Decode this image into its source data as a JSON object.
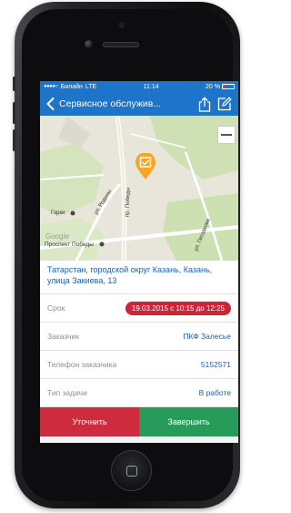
{
  "statusbar": {
    "carrier": "Билайн",
    "network": "LTE",
    "time": "11:14",
    "battery": "20 %",
    "battery_level": 0.2
  },
  "navbar": {
    "title": "Сервисное обслужив...",
    "back_icon": "chevron-left-icon",
    "share_icon": "share-icon",
    "edit_icon": "edit-icon"
  },
  "map": {
    "labels": {
      "street1": "ул. Родины",
      "street2": "пр. Победы",
      "street3": "ул. Гвоздкова",
      "place1": "Горки",
      "place2": "Проспект Победы",
      "logo": "Google"
    },
    "pin_color": "#f5a623"
  },
  "task": {
    "address": "Татарстан, городской округ Казань, Казань, улица Закиева, 13",
    "rows": [
      {
        "label": "Срок",
        "value": "19.03.2015 с 10:15 до 12:25",
        "pill": true
      },
      {
        "label": "Заказчик",
        "value": "ПКФ Залесье",
        "pill": false
      },
      {
        "label": "Телефон заказчика",
        "value": "5152571",
        "pill": false
      },
      {
        "label": "Тип задачи",
        "value": "В работе",
        "pill": false
      }
    ]
  },
  "actions": {
    "refine": "Уточнить",
    "finish": "Завершить"
  },
  "colors": {
    "accent": "#1d74c9",
    "danger": "#cc2438",
    "success": "#279c5a"
  }
}
